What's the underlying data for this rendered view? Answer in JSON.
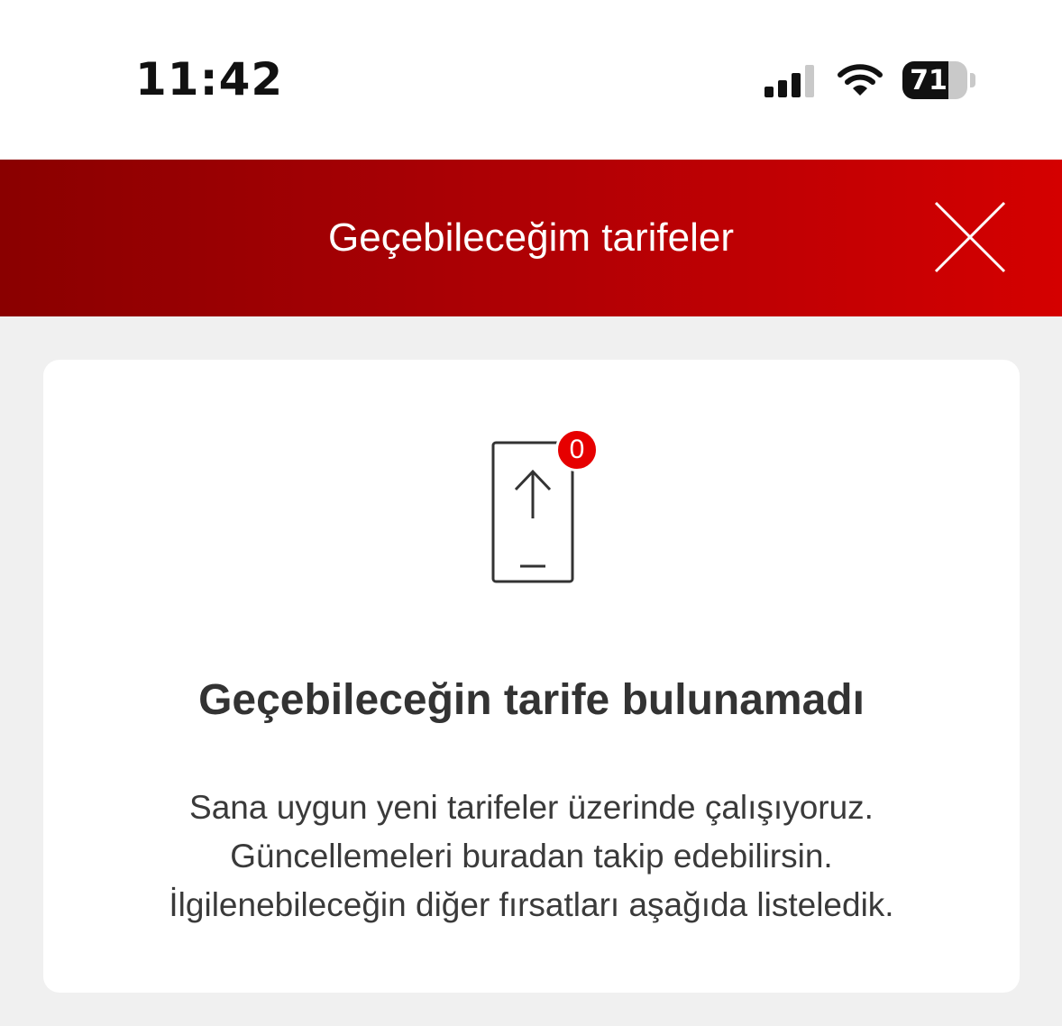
{
  "status_bar": {
    "time": "11:42",
    "battery_level": "71",
    "signal_bars_active": 3,
    "signal_bars_total": 4
  },
  "header": {
    "title": "Geçebileceğim tarifeler",
    "close_icon": "close-icon",
    "background_start": "#8a0000",
    "background_end": "#d40000"
  },
  "empty_state": {
    "illustration_icon": "phone-upgrade-icon",
    "badge_count": "0",
    "badge_color": "#e60000",
    "title": "Geçebileceğin tarife bulunamadı",
    "description_lines": [
      "Sana uygun yeni tarifeler üzerinde çalışıyoruz.",
      "Güncellemeleri buradan takip edebilirsin.",
      "İlgilenebileceğin diğer fırsatları aşağıda listeledik."
    ]
  }
}
